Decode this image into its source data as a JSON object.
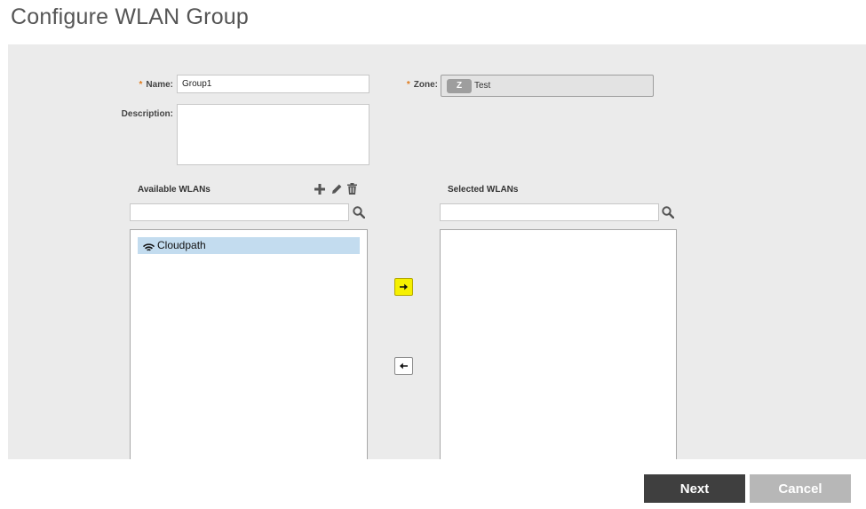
{
  "page": {
    "title": "Configure WLAN Group"
  },
  "form": {
    "required_marker": "*",
    "name_label": "Name:",
    "name_value": "Group1",
    "description_label": "Description:",
    "description_value": "",
    "zone_label": "Zone:",
    "zone_badge": "Z",
    "zone_value": "Test"
  },
  "available": {
    "title": "Available WLANs",
    "search_value": "",
    "items": [
      {
        "label": "Cloudpath",
        "icon": "wifi-icon",
        "selected": true
      }
    ]
  },
  "selected": {
    "title": "Selected WLANs",
    "search_value": "",
    "items": []
  },
  "colors": {
    "accent_required": "#e07b1c",
    "move_right_highlight": "#f6f000",
    "list_item_selected": "#c3dcef",
    "next_button": "#3f3f3f",
    "cancel_button": "#b7b7b7"
  },
  "footer": {
    "next_label": "Next",
    "cancel_label": "Cancel"
  }
}
